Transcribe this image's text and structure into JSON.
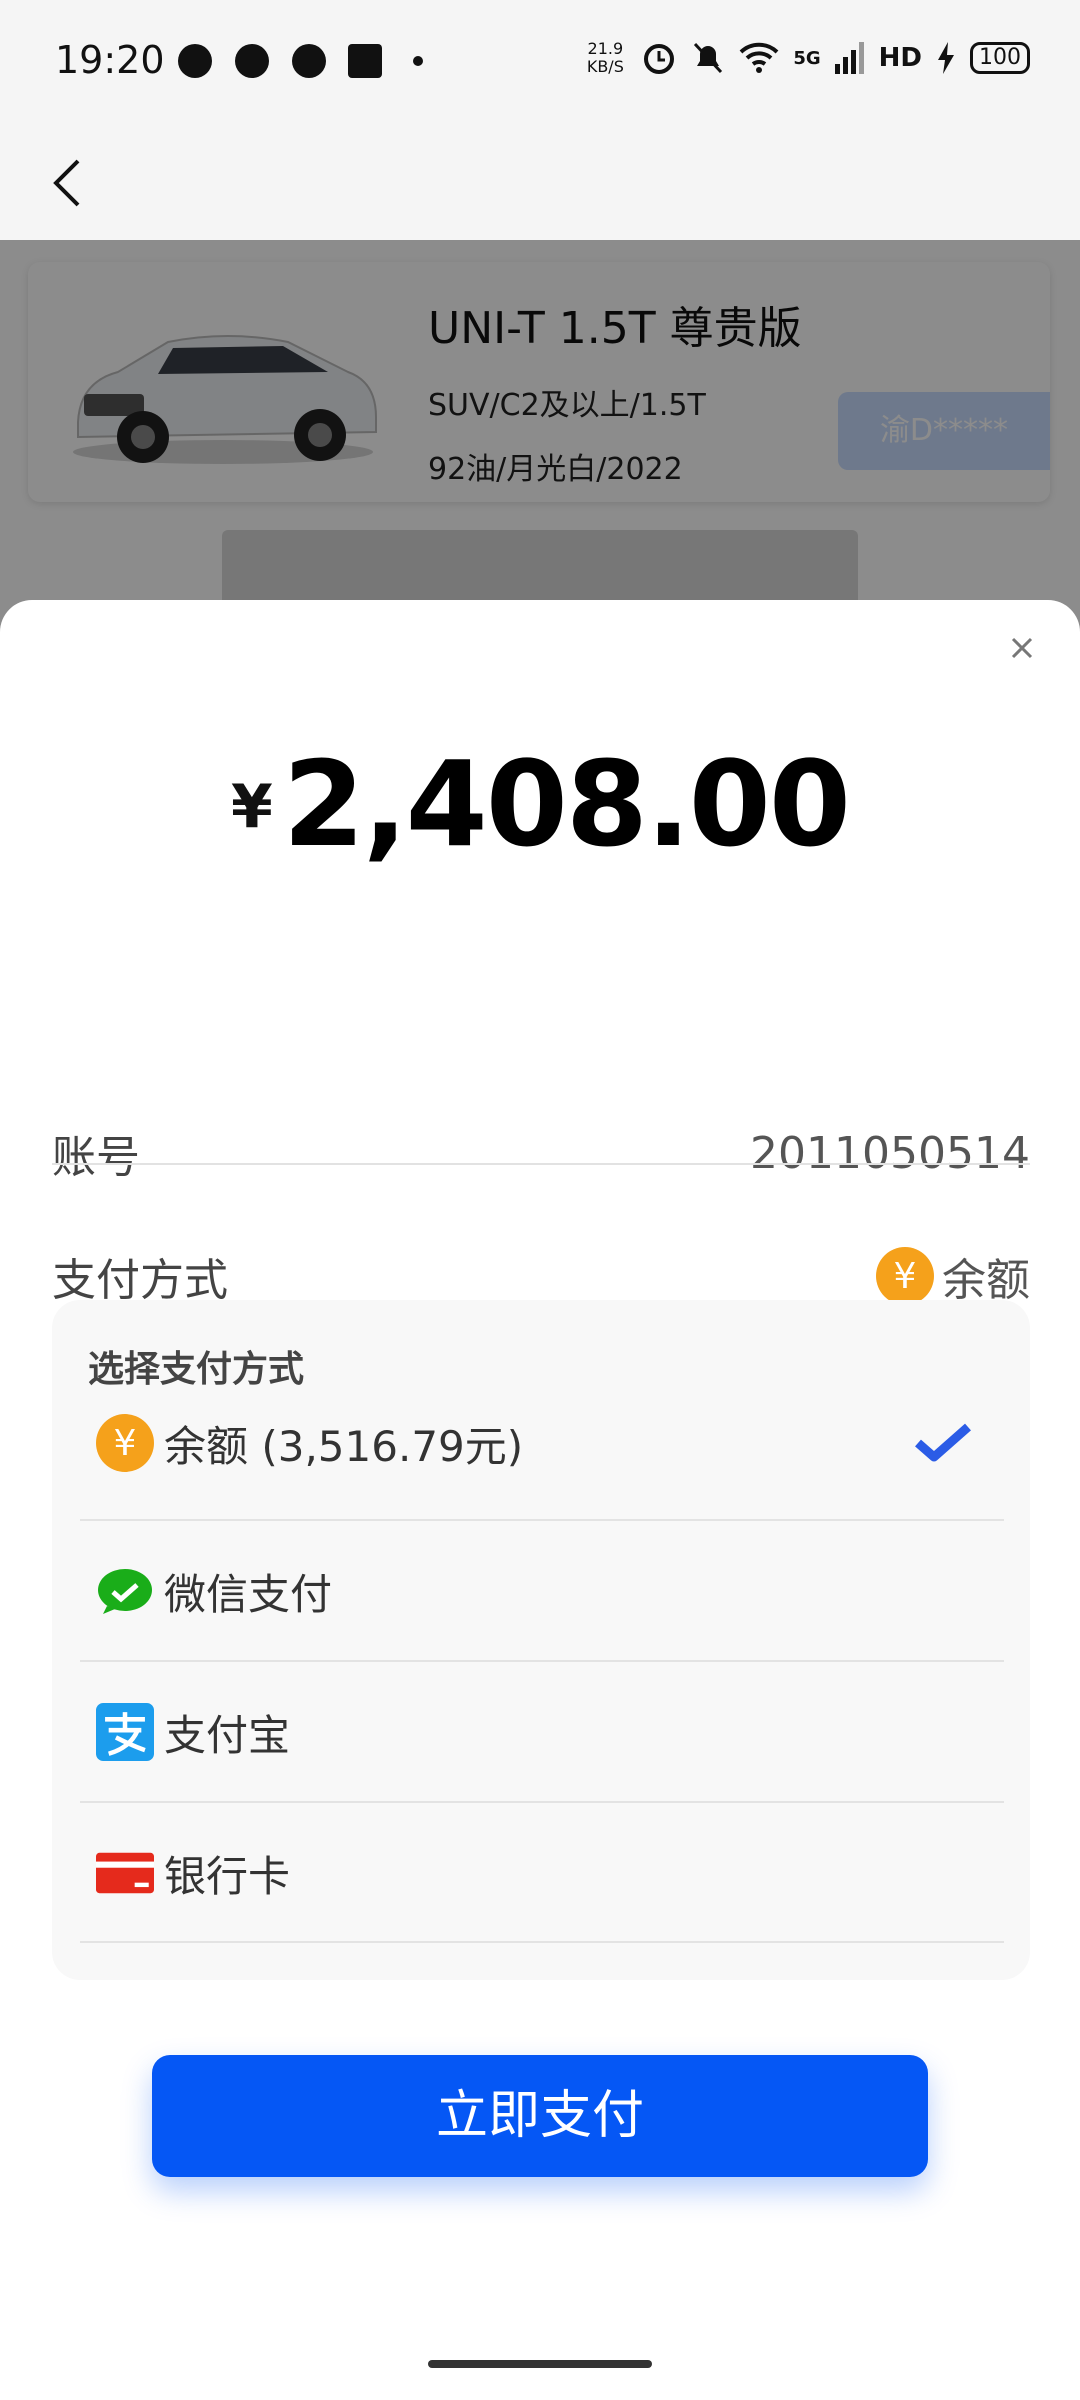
{
  "status_bar": {
    "time": "19:20",
    "net_speed": "21.9 KB/S",
    "network": "5G",
    "hd": "HD",
    "battery": "100"
  },
  "nav": {
    "back_icon": "chevron-left-icon"
  },
  "car": {
    "title": "UNI-T 1.5T 尊贵版",
    "spec": "SUV/C2及以上/1.5T",
    "meta": "92油/月光白/2022",
    "plate": "渝D*****"
  },
  "payment_sheet": {
    "currency": "¥",
    "amount": "2,408.00",
    "account_label": "账号",
    "account_value": "2011050514",
    "method_label": "支付方式",
    "method_value": "余额",
    "choose_title": "选择支付方式",
    "options": [
      {
        "label": "余额 (3,516.79元)",
        "icon": "balance-coin-icon",
        "selected": true
      },
      {
        "label": "微信支付",
        "icon": "wechat-icon",
        "selected": false
      },
      {
        "label": "支付宝",
        "icon": "alipay-icon",
        "selected": false
      },
      {
        "label": "银行卡",
        "icon": "bank-card-icon",
        "selected": false
      }
    ],
    "pay_button": "立即支付"
  },
  "colors": {
    "primary": "#0557f5",
    "coin": "#f5a11b",
    "wechat": "#1aad19",
    "alipay": "#1677ff",
    "bank": "#e52a1c",
    "check": "#2b5ce6"
  }
}
